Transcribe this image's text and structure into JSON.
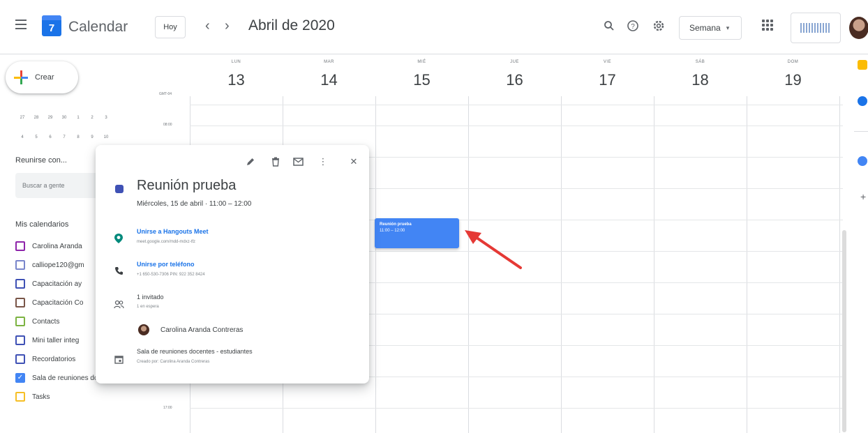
{
  "header": {
    "app_title": "Calendar",
    "logo_day": "7",
    "today_label": "Hoy",
    "prev_icon": "‹",
    "next_icon": "›",
    "month_title": "Abril de 2020",
    "view_label": "Semana",
    "view_caret": "▾",
    "search_icon": "🔍",
    "help_icon": "?",
    "settings_icon": "⚙"
  },
  "sidebar": {
    "create_label": "Crear",
    "mini_calendar_rows": [
      [
        "27",
        "28",
        "29",
        "30",
        "1",
        "2",
        "3"
      ],
      [
        "4",
        "5",
        "6",
        "7",
        "8",
        "9",
        "10"
      ]
    ],
    "meet_heading": "Reunirse con...",
    "people_search_placeholder": "Buscar a gente",
    "my_calendars_heading": "Mis calendarios",
    "calendars": [
      {
        "label": "Carolina Aranda",
        "color": "#8e24aa",
        "checked": false
      },
      {
        "label": "calliope120@gm",
        "color": "#7986cb",
        "checked": false
      },
      {
        "label": "Capacitación ay",
        "color": "#3f51b5",
        "checked": false
      },
      {
        "label": "Capacitación Co",
        "color": "#795548",
        "checked": false
      },
      {
        "label": "Contacts",
        "color": "#7cb342",
        "checked": false
      },
      {
        "label": "Mini taller integ",
        "color": "#3f51b5",
        "checked": false
      },
      {
        "label": "Recordatorios",
        "color": "#3f51b5",
        "checked": false
      },
      {
        "label": "Sala de reuniones docente...",
        "color": "#4285f4",
        "checked": true
      },
      {
        "label": "Tasks",
        "color": "#f6bf26",
        "checked": false
      }
    ]
  },
  "grid": {
    "timezone": "GMT-04",
    "days": [
      {
        "name": "LUN",
        "num": "13"
      },
      {
        "name": "MAR",
        "num": "14"
      },
      {
        "name": "MIÉ",
        "num": "15"
      },
      {
        "name": "JUE",
        "num": "16"
      },
      {
        "name": "VIE",
        "num": "17"
      },
      {
        "name": "SÁB",
        "num": "18"
      },
      {
        "name": "DOM",
        "num": "19"
      }
    ],
    "time_labels": [
      "08:00",
      "17:00"
    ]
  },
  "event": {
    "title": "Reunión prueba",
    "time": "11:00 – 12:00",
    "color": "#4285f4"
  },
  "popover": {
    "edit_icon": "✎",
    "delete_icon": "🗑",
    "email_icon": "✉",
    "more_icon": "⋮",
    "close_icon": "✕",
    "title": "Reunión prueba",
    "date": "Miércoles, 15 de abril · 11:00 – 12:00",
    "meet_link": "Unirse a Hangouts Meet",
    "meet_url": "meet.google.com/mdd-mdxz-tfz",
    "phone_link": "Unirse por teléfono",
    "phone_detail": "+1 650-530-7306 PIN: 922 352 8424",
    "guests_count": "1 invitado",
    "guests_status": "1 en espera",
    "guest_name": "Carolina Aranda Contreras",
    "calendar_name": "Sala de reuniones docentes - estudiantes",
    "created_by": "Creado por: Carolina Aranda Contreras",
    "accent_color": "#3f51b5",
    "link_color": "#1a73e8"
  },
  "annotation": {
    "arrow_color": "#e53935"
  }
}
